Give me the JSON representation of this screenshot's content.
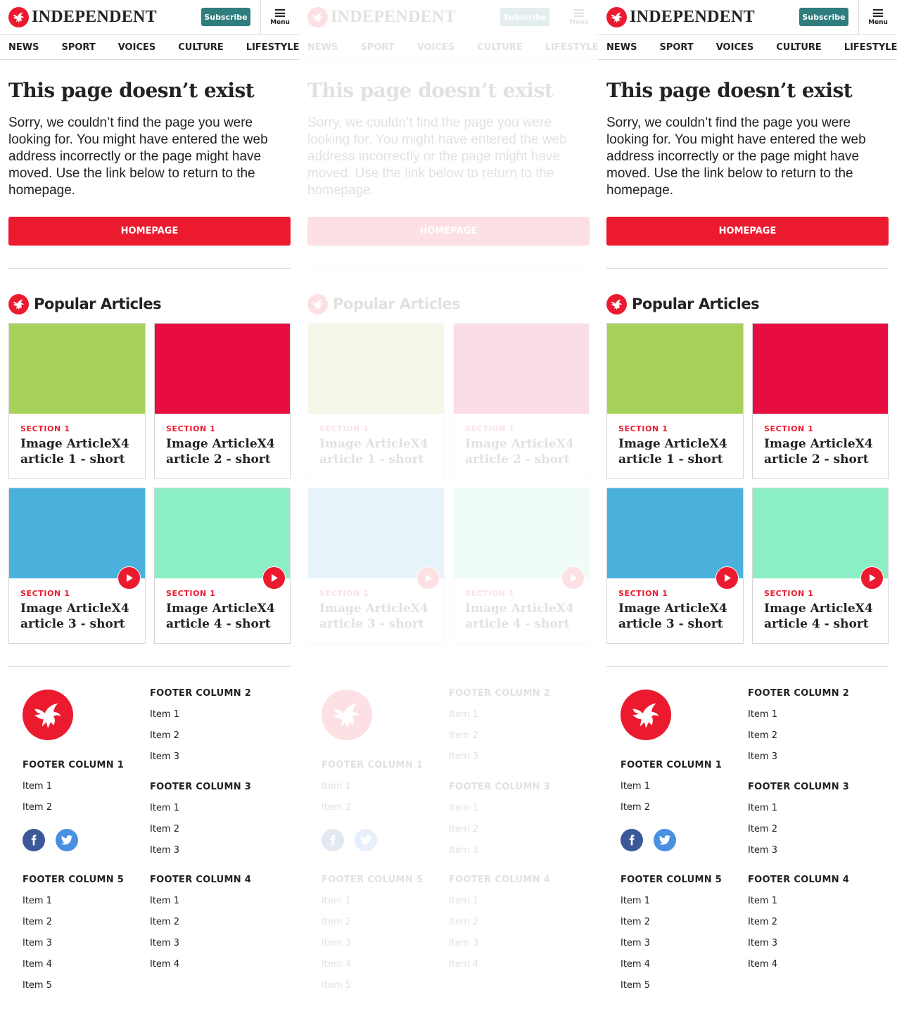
{
  "header": {
    "logo_text": "INDEPENDENT",
    "subscribe_label": "Subscribe",
    "menu_label": "Menu"
  },
  "nav": [
    "NEWS",
    "SPORT",
    "VOICES",
    "CULTURE",
    "LIFESTYLE"
  ],
  "main": {
    "title": "This page doesn’t exist",
    "body": "Sorry, we couldn’t find the page you were looking for. You might have entered the web address incorrectly or the page might have moved. Use the link below to return to the homepage.",
    "home_button": "HOMEPAGE"
  },
  "popular": {
    "title": "Popular Articles",
    "articles": [
      {
        "section": "SECTION 1",
        "title": "Image ArticleX4 article 1 - short",
        "color": "#a8d15b",
        "video": false
      },
      {
        "section": "SECTION 1",
        "title": "Image ArticleX4 article 2 - short",
        "color": "#e80d40",
        "video": false
      },
      {
        "section": "SECTION 1",
        "title": "Image ArticleX4 article 3 - short",
        "color": "#4ab1dd",
        "video": true
      },
      {
        "section": "SECTION 1",
        "title": "Image ArticleX4 article 4 - short",
        "color": "#8aefc4",
        "video": true
      }
    ]
  },
  "footer": {
    "columns": {
      "col1": {
        "title": "FOOTER COLUMN 1",
        "items": [
          "Item 1",
          "Item 2"
        ]
      },
      "col2": {
        "title": "FOOTER COLUMN 2",
        "items": [
          "Item 1",
          "Item 2",
          "Item 3"
        ]
      },
      "col3": {
        "title": "FOOTER COLUMN 3",
        "items": [
          "Item 1",
          "Item 2",
          "Item 3"
        ]
      },
      "col4": {
        "title": "FOOTER COLUMN 4",
        "items": [
          "Item 1",
          "Item 2",
          "Item 3",
          "Item 4"
        ]
      },
      "col5": {
        "title": "FOOTER COLUMN 5",
        "items": [
          "Item 1",
          "Item 2",
          "Item 3",
          "Item 4",
          "Item 5"
        ]
      }
    },
    "social": [
      "facebook-icon",
      "twitter-icon"
    ]
  },
  "colors": {
    "brand_red": "#ec1a2e",
    "subscribe_teal": "#2f7d7d",
    "facebook": "#3b5998",
    "twitter": "#4a90e2"
  },
  "panels": [
    {
      "state": "loaded"
    },
    {
      "state": "loading"
    },
    {
      "state": "loaded"
    }
  ]
}
